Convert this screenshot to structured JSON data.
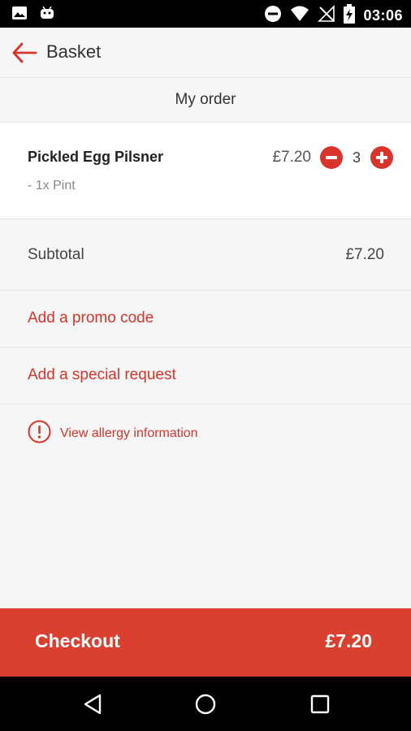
{
  "status_bar": {
    "time": "03:06",
    "left_icons": [
      "image-icon",
      "android-icon"
    ],
    "right_icons": [
      "do-not-disturb-icon",
      "wifi-icon",
      "no-signal-icon",
      "battery-charging-icon"
    ]
  },
  "app_bar": {
    "back_icon": "arrow-left-icon",
    "title": "Basket"
  },
  "section": {
    "title": "My order"
  },
  "order_items": [
    {
      "name": "Pickled Egg Pilsner",
      "option": "- 1x Pint",
      "price": "£7.20",
      "quantity": "3"
    }
  ],
  "subtotal": {
    "label": "Subtotal",
    "value": "£7.20"
  },
  "promo": {
    "label": "Add a promo code"
  },
  "special_request": {
    "label": "Add a special request"
  },
  "allergy": {
    "label": "View allergy information"
  },
  "checkout": {
    "label": "Checkout",
    "total": "£7.20"
  },
  "colors": {
    "accent": "#d9342b",
    "checkout_bg": "#d9402f",
    "background": "#f6f6f6"
  }
}
